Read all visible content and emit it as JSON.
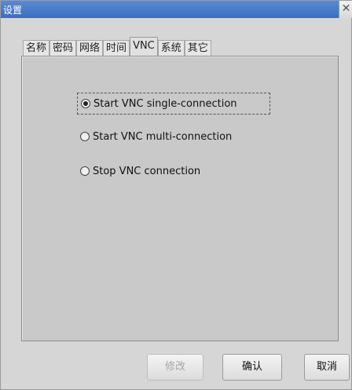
{
  "window": {
    "title": "设置",
    "close_symbol": "✕"
  },
  "tabs": [
    {
      "label": "名称",
      "active": false
    },
    {
      "label": "密码",
      "active": false
    },
    {
      "label": "网络",
      "active": false
    },
    {
      "label": "时间",
      "active": false
    },
    {
      "label": "VNC",
      "active": true
    },
    {
      "label": "系统",
      "active": false
    },
    {
      "label": "其它",
      "active": false
    }
  ],
  "vnc": {
    "options": [
      {
        "label": "Start VNC single-connection",
        "checked": true
      },
      {
        "label": "Start VNC multi-connection",
        "checked": false
      },
      {
        "label": "Stop VNC connection",
        "checked": false
      }
    ]
  },
  "buttons": {
    "modify": "修改",
    "confirm": "确认",
    "cancel": "取消"
  }
}
